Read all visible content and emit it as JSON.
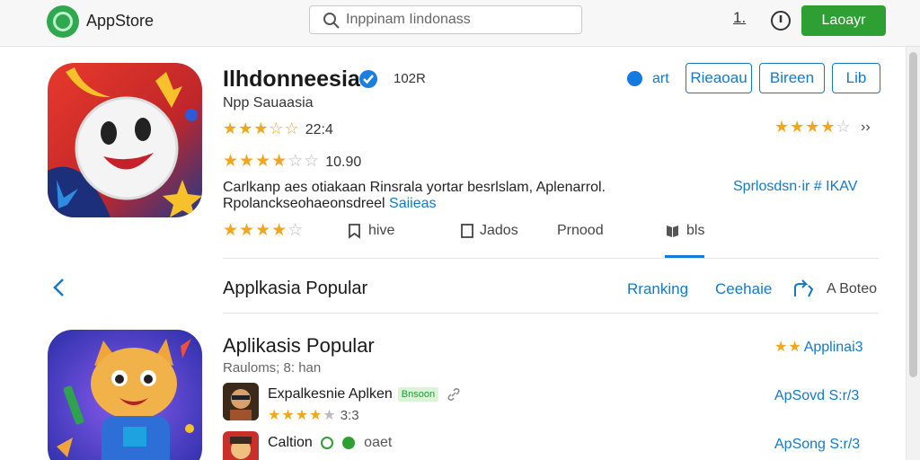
{
  "header": {
    "brand": "AppStore",
    "search_value": "Inppinam Iindonass",
    "counter": "1.",
    "login_label": "Laoayr"
  },
  "hero": {
    "title": "Ilhdonneesia ·",
    "count": "102R",
    "subtitle": "Npp Sauaasia",
    "rating1": {
      "stars": "★★★☆☆",
      "value": "22:4"
    },
    "rating2": {
      "stars": "★★★★",
      "off": "☆☆",
      "value": "10.90"
    },
    "desc_line1": "Carlkanp aes otiakaan Rinsrala yortar besrlslam, Aplenarrol.",
    "desc_line2": "Rpolanckseohaeonsdreel",
    "desc_link": "Saiieas",
    "rating3": {
      "stars": "★★★★",
      "off": "☆"
    },
    "art_label": "art",
    "buttons": [
      "Rieaoau",
      "Bireen",
      "Lib"
    ],
    "right_stars": {
      "stars": "★★★★",
      "off": "☆"
    },
    "right_chevron": "››",
    "right_link": "Sprlosdsn·ir # IKAV"
  },
  "tabs": [
    {
      "label": "hive",
      "icon": "bookmark-icon"
    },
    {
      "label": "Jados",
      "icon": "note-icon"
    },
    {
      "label": "Prnood",
      "icon": ""
    },
    {
      "label": "bls",
      "icon": "book-icon"
    }
  ],
  "section": {
    "title": "Applkasia Popular",
    "link1": "Rranking",
    "link2": "Cеehaie",
    "about": "A Boteo"
  },
  "featured": {
    "title": "Aplikasis Popular",
    "subtitle": "Rauloms; 8: han",
    "right_stars": "★★",
    "right_text": "Applinai3",
    "items": [
      {
        "title": "Expalkesnie Aplken",
        "badge": "Bnsoon",
        "stars": "★★★★",
        "half": "★",
        "value": "3:3",
        "link": "ApSovd S:r/3"
      },
      {
        "title": "Caltion",
        "link": "ApSong S:r/3",
        "tail": "oaet"
      }
    ]
  },
  "colors": {
    "accent": "#1479c9",
    "brand_green": "#2e9f32",
    "star": "#f2a51f"
  }
}
